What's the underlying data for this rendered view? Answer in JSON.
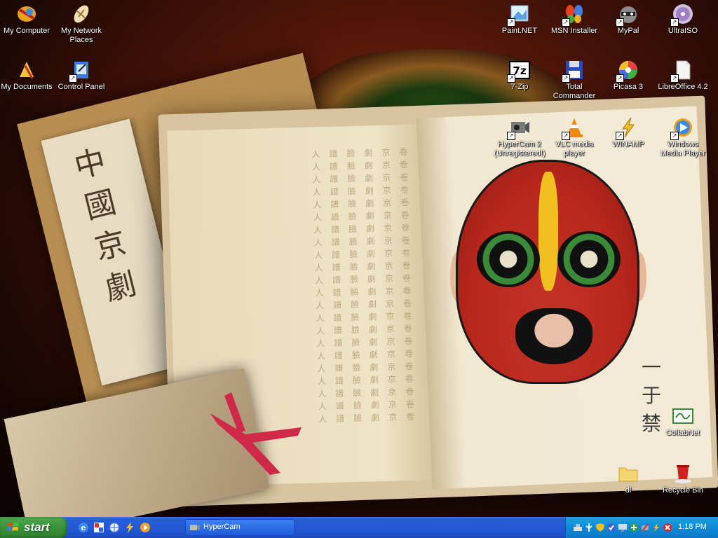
{
  "desktop": {
    "icons_left": [
      {
        "label": "My Computer",
        "icon": "my-computer-icon"
      },
      {
        "label": "My Network Places",
        "icon": "network-places-icon"
      },
      {
        "label": "My Documents",
        "icon": "my-documents-icon"
      },
      {
        "label": "Control Panel",
        "icon": "control-panel-icon"
      }
    ],
    "icons_right": [
      {
        "label": "Paint.NET",
        "icon": "paint-net-icon"
      },
      {
        "label": "MSN Installer",
        "icon": "msn-butterfly-icon"
      },
      {
        "label": "MyPal",
        "icon": "mypal-raccoon-icon"
      },
      {
        "label": "UltraISO",
        "icon": "disc-icon"
      },
      {
        "label": "7-Zip",
        "icon": "7zip-icon"
      },
      {
        "label": "Total Commander",
        "icon": "floppy-disk-icon"
      },
      {
        "label": "Picasa 3",
        "icon": "picasa-icon"
      },
      {
        "label": "LibreOffice 4.2",
        "icon": "document-icon"
      },
      {
        "label": "HyperCam 2 (Unregistered!)",
        "icon": "video-camera-icon"
      },
      {
        "label": "VLC media player",
        "icon": "vlc-cone-icon"
      },
      {
        "label": "WINAMP",
        "icon": "winamp-bolt-icon"
      },
      {
        "label": "Windows Media Player",
        "icon": "media-player-icon"
      },
      {
        "label": "CollabNet",
        "icon": "collabnet-icon"
      },
      {
        "label": "dl",
        "icon": "folder-icon"
      },
      {
        "label": "Recycle Bin",
        "icon": "recycle-bin-icon"
      }
    ]
  },
  "wallpaper": {
    "scroll_text": "中國京劇",
    "signature": "一于禁"
  },
  "taskbar": {
    "start_label": "start",
    "quick_launch": [
      "internet-explorer-icon",
      "paint-icon",
      "browser-icon",
      "winamp-bolt-icon",
      "media-player-icon"
    ],
    "task_button_label": "HyperCam",
    "tray_icons": [
      "network-icon",
      "usb-icon",
      "shield-icon",
      "security-icon",
      "monitor-icon",
      "antivirus-icon",
      "remove-hardware-icon",
      "winamp-bolt-icon",
      "alert-icon"
    ],
    "clock": "1:18 PM"
  }
}
